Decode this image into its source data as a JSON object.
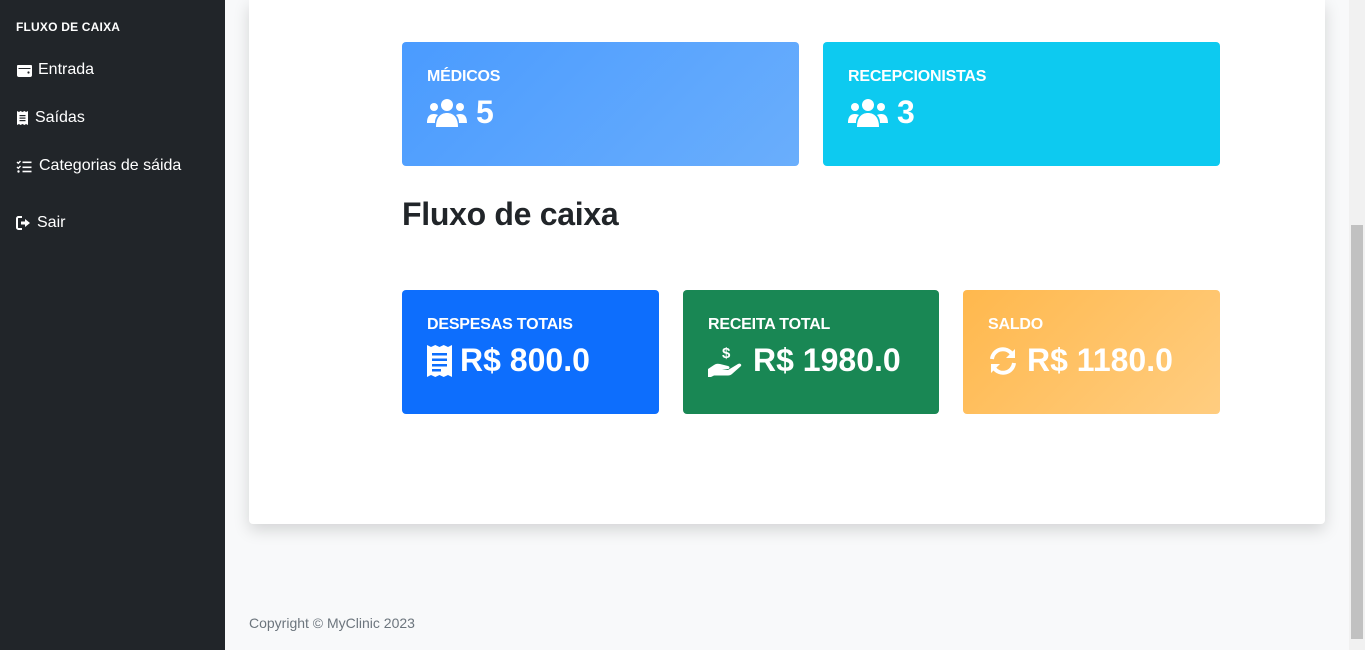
{
  "sidebar": {
    "heading": "FLUXO DE CAIXA",
    "items": [
      {
        "label": "Entrada",
        "icon": "wallet-icon"
      },
      {
        "label": "Saídas",
        "icon": "receipt-icon"
      },
      {
        "label": "Categorias de sáida",
        "icon": "list-check-icon"
      },
      {
        "label": "Sair",
        "icon": "sign-out-icon"
      }
    ]
  },
  "cards": {
    "medicos": {
      "label": "MÉDICOS",
      "value": "5",
      "icon": "users-icon",
      "color": "#4a9bff"
    },
    "recepcionistas": {
      "label": "RECEPCIONISTAS",
      "value": "3",
      "icon": "users-icon",
      "color": "#0dcaf0"
    }
  },
  "section_title": "Fluxo de caixa",
  "finance": {
    "despesas": {
      "label": "DESPESAS TOTAIS",
      "value": "R$ 800.0",
      "icon": "receipt-icon",
      "color": "#0d6efd"
    },
    "receita": {
      "label": "RECEITA TOTAL",
      "value": "R$ 1980.0",
      "icon": "hand-holding-dollar-icon",
      "color": "#198754"
    },
    "saldo": {
      "label": "SALDO",
      "value": "R$ 1180.0",
      "icon": "sync-icon",
      "color": "#ffb84d"
    }
  },
  "footer": {
    "copyright": "Copyright © MyClinic 2023"
  }
}
